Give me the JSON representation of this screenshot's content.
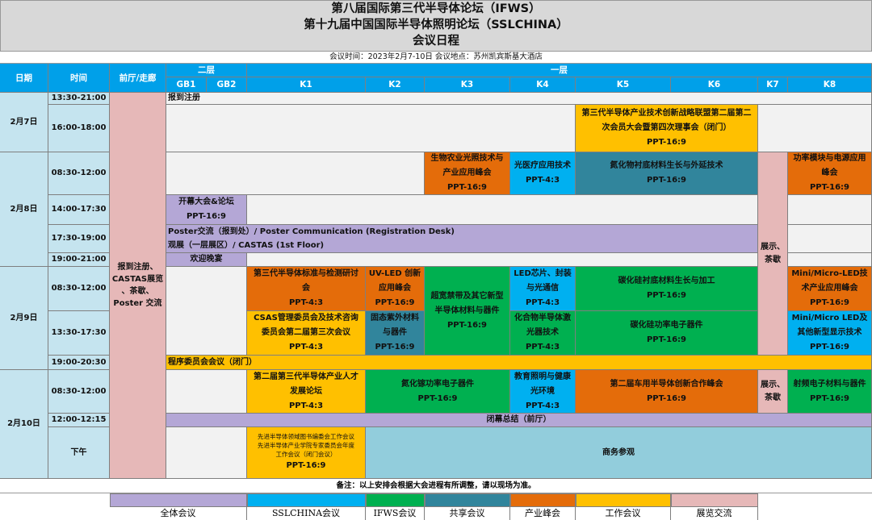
{
  "header": {
    "line1": "第八届国际第三代半导体论坛（IFWS）",
    "line2": "第十九届中国国际半导体照明论坛（SSLCHINA）",
    "line3": "会议日程"
  },
  "info": "会议时间：2023年2月7-10日      会议地点：苏州凯宾斯基大酒店",
  "cols": {
    "date": "日期",
    "time": "时间",
    "hall": "前厅/走廊",
    "floor2": "二层",
    "floor1": "一层",
    "gb1": "GB1",
    "gb2": "GB2",
    "k1": "K1",
    "k2": "K2",
    "k3": "K3",
    "k4": "K4",
    "k5": "K5",
    "k6": "K6",
    "k7": "K7",
    "k8": "K8"
  },
  "dates": {
    "d7": "2月7日",
    "d8": "2月8日",
    "d9": "2月9日",
    "d10": "2月10日"
  },
  "times": {
    "t1": "13:30-21:00",
    "t2": "16:00-18:00",
    "t3": "08:30-12:00",
    "t4": "14:00-17:30",
    "t5": "17:30-19:00",
    "t6": "19:00-21:00",
    "t7": "08:30-12:00",
    "t8": "13:30-17:30",
    "t9": "19:00-20:30",
    "t10": "08:30-12:00",
    "t11": "12:00-12:15",
    "t12": "下午"
  },
  "hall": "报到注册、\nCASTAS展览\n、茶歇、\nPoster 交流",
  "events": {
    "reg": "报到注册",
    "alliance": "第三代半导体产业技术创新战略联盟第二届第二\n次会员大会暨第四次理事会（闭门）\nPPT-16:9",
    "bio": "生物农业光照技术与\n产业应用峰会\nPPT-16:9",
    "medical": "光医疗应用技术\nPPT-4:3",
    "gan_sub": "氮化物衬底材料生长与外延技术\nPPT-16:9",
    "expo_k7_8": "展示、\n茶歇",
    "power_module": "功率模块与电源应用\n峰会\nPPT-16:9",
    "opening": "开幕大会&论坛\nPPT-16:9",
    "poster": "Poster交流（报到处）/ Poster Communication (Registration Desk)\n观展（一层展区）/ CASTAS (1st Floor)",
    "dinner": "欢迎晚宴",
    "std": "第三代半导体标准与检测研讨\n会\nPPT-4:3",
    "uvled": "UV-LED 创新\n应用峰会\nPPT-16:9",
    "ultra": "超宽禁带及其它新型\n半导体材料与器件\nPPT-16:9",
    "ledchip": "LED芯片、封装\n与光通信\nPPT-4:3",
    "sic_sub": "碳化硅衬底材料生长与加工\nPPT-16:9",
    "microled1": "Mini/Micro-LED技\n术产业应用峰会\nPPT-16:9",
    "csas": "CSAS管理委员会及技术咨询\n委员会第二届第三次会议\nPPT-4:3",
    "solid_uv": "固态紫外材料\n与器件\nPPT-16:9",
    "compound": "化合物半导体激\n光器技术\nPPT-4:3",
    "sic_power": "碳化硅功率电子器件\nPPT-16:9",
    "microled2": "Mini/Micro LED及\n其他新型显示技术\nPPT-16:9",
    "program": "程序委员会会议（闭门）",
    "industry": "第二届第三代半导体产业人才\n发展论坛\nPPT-4:3",
    "gan_power": "氮化镓功率电子器件\nPPT-16:9",
    "edu": "教育照明与健康\n光环境\nPPT-4:3",
    "auto": "第二届车用半导体创新合作峰会\nPPT-16:9",
    "expo_k7_10": "展示、\n茶歇",
    "rf": "射频电子材料与器件\nPPT-16:9",
    "closing": "闭幕总结（前厅）",
    "adv_small": "先进半导体领域图书编委会工作会议\n先进半导体产业学院专家委员会年度\n工作会议（闭门会议）",
    "adv_ppt": "PPT-16:9",
    "business": "商务参观"
  },
  "note": "备注：以上安排会根据大会进程有所调整，请以现场为准。",
  "legend": [
    {
      "label": "全体会议",
      "color": "#b4a7d6"
    },
    {
      "label": "SSLCHINA会议",
      "color": "#00b0f0"
    },
    {
      "label": "IFWS会议",
      "color": "#00b050"
    },
    {
      "label": "共享会议",
      "color": "#31859c"
    },
    {
      "label": "产业峰会",
      "color": "#e46c0a"
    },
    {
      "label": "工作会议",
      "color": "#ffc000"
    },
    {
      "label": "展览交流",
      "color": "#e6b8b8"
    }
  ]
}
